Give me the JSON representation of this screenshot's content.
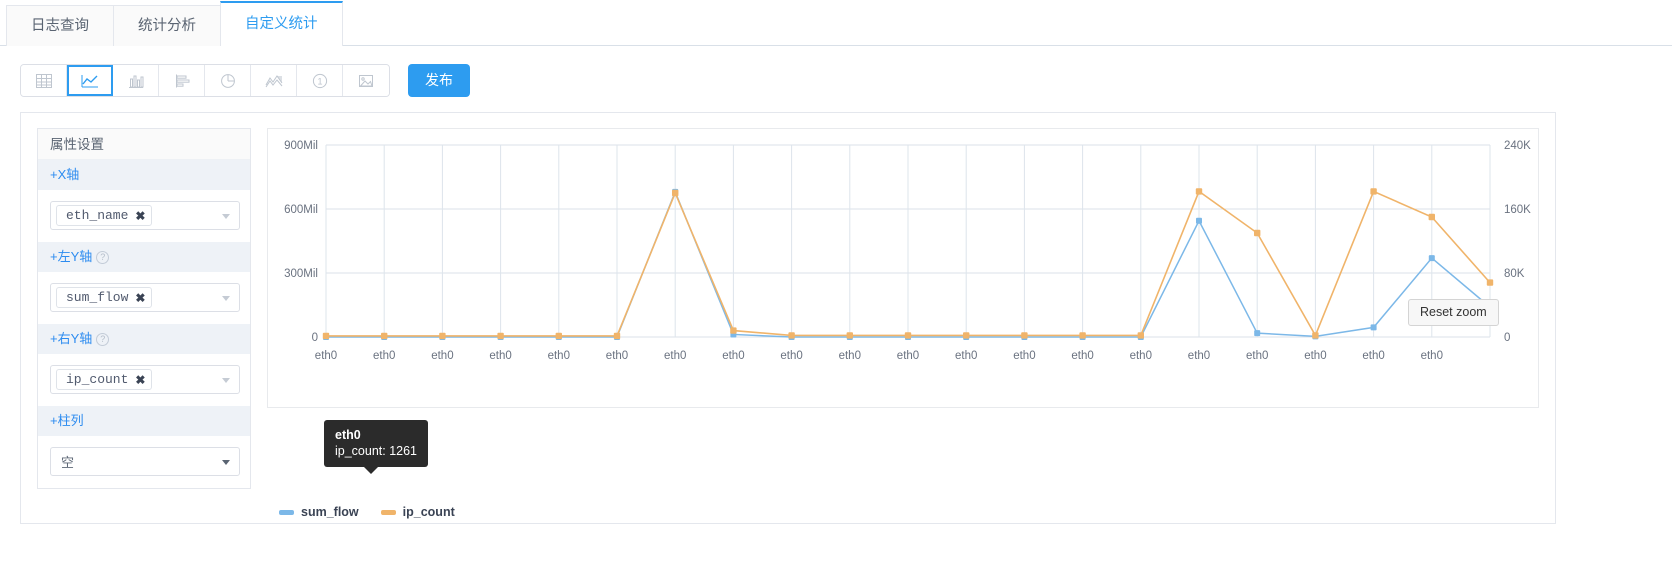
{
  "tabs": [
    {
      "label": "日志查询",
      "active": false
    },
    {
      "label": "统计分析",
      "active": false
    },
    {
      "label": "自定义统计",
      "active": true
    }
  ],
  "toolbar": {
    "icons": [
      {
        "name": "table-chart-icon",
        "active": false
      },
      {
        "name": "line-chart-icon",
        "active": true
      },
      {
        "name": "column-chart-icon",
        "active": false
      },
      {
        "name": "horizontal-bar-chart-icon",
        "active": false
      },
      {
        "name": "pie-chart-icon",
        "active": false
      },
      {
        "name": "area-chart-icon",
        "active": false
      },
      {
        "name": "single-number-icon",
        "active": false
      },
      {
        "name": "map-chart-icon",
        "active": false
      }
    ],
    "publish_label": "发布",
    "accent_color": "#2d9cf0"
  },
  "settings": {
    "title": "属性设置",
    "sections": [
      {
        "head": "+X轴",
        "help": false,
        "value": "eth_name",
        "remove": "✖"
      },
      {
        "head": "+左Y轴",
        "help": true,
        "value": "sum_flow",
        "remove": "✖"
      },
      {
        "head": "+右Y轴",
        "help": true,
        "value": "ip_count",
        "remove": "✖"
      },
      {
        "head": "+柱列",
        "help": false,
        "value": "空",
        "remove": ""
      }
    ],
    "help_glyph": "?"
  },
  "chart_controls": {
    "reset_zoom_label": "Reset zoom"
  },
  "tooltip": {
    "title": "eth0",
    "line": "ip_count: 1261"
  },
  "chart_data": {
    "type": "line",
    "title": "",
    "xlabel": "",
    "ylabel": "",
    "grid": true,
    "legend_position": "bottom-left",
    "categories": [
      "eth0",
      "eth0",
      "eth0",
      "eth0",
      "eth0",
      "eth0",
      "eth0",
      "eth0",
      "eth0",
      "eth0",
      "eth0",
      "eth0",
      "eth0",
      "eth0",
      "eth0",
      "eth0",
      "eth0",
      "eth0",
      "eth0",
      "eth0"
    ],
    "left_axis": {
      "label": "sum_flow",
      "ticks": [
        "0",
        "300Mil",
        "600Mil",
        "900Mil"
      ],
      "min": 0,
      "max": 900
    },
    "right_axis": {
      "label": "ip_count",
      "ticks": [
        "0",
        "80K",
        "160K",
        "240K"
      ],
      "min": 0,
      "max": 240
    },
    "series": [
      {
        "name": "sum_flow",
        "color": "#7cb8e8",
        "axis": "left",
        "unit": "Mil",
        "values": [
          0,
          0,
          0,
          0,
          0,
          0,
          680,
          12,
          0,
          0,
          0,
          0,
          0,
          0,
          0,
          545,
          18,
          3,
          45,
          370,
          140
        ]
      },
      {
        "name": "ip_count",
        "color": "#f0b46a",
        "axis": "right",
        "unit": "K",
        "values": [
          1.3,
          1.3,
          1.3,
          1.3,
          1.3,
          1.3,
          180,
          8,
          2,
          2,
          2,
          2,
          2,
          2,
          2,
          182,
          130,
          2,
          182,
          150,
          68
        ]
      }
    ]
  },
  "legend": [
    {
      "label": "sum_flow",
      "color": "#7cb8e8"
    },
    {
      "label": "ip_count",
      "color": "#f0b46a"
    }
  ]
}
